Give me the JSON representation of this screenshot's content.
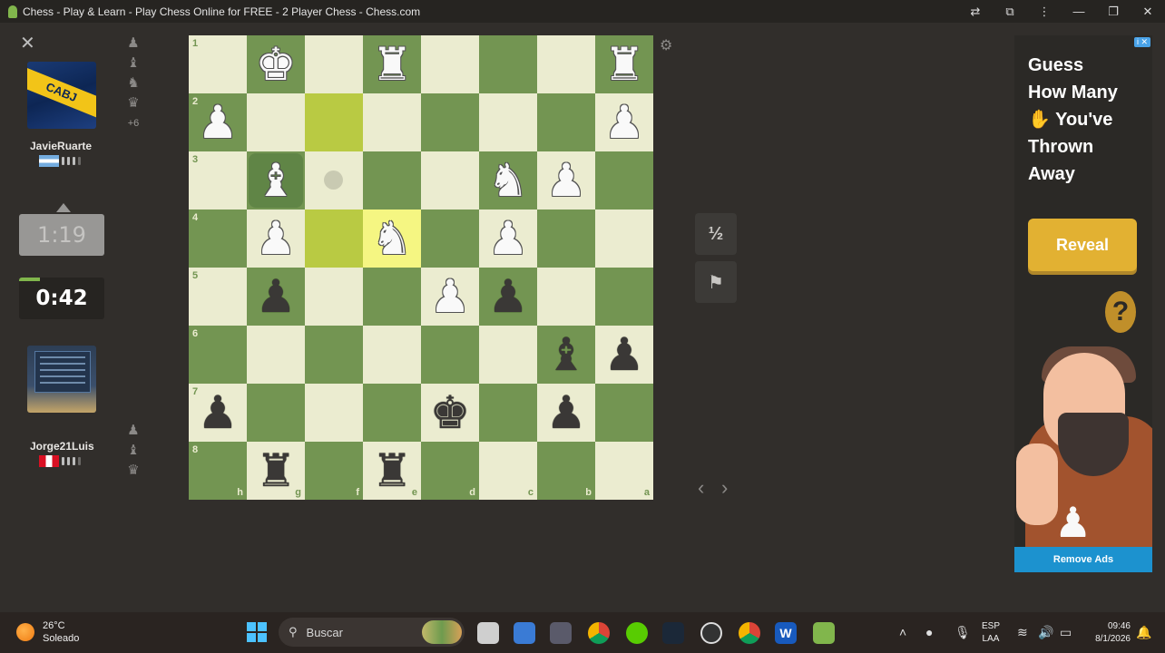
{
  "window": {
    "title": "Chess - Play & Learn - Play Chess Online for FREE - 2 Player Chess - Chess.com"
  },
  "top_player": {
    "name": "JavieRuarte",
    "avatar_text": "CABJ",
    "captured": [
      "♟",
      "♝",
      "♞",
      "♛"
    ],
    "advantage": "+6",
    "clock": "1:19"
  },
  "bottom_player": {
    "name": "Jorge21Luis",
    "captured": [
      "♟",
      "♝",
      "♛"
    ],
    "clock": "0:42"
  },
  "board": {
    "ranks": [
      "1",
      "2",
      "3",
      "4",
      "5",
      "6",
      "7",
      "8"
    ],
    "files": [
      "h",
      "g",
      "f",
      "e",
      "d",
      "c",
      "b",
      "a"
    ],
    "highlight_squares": [
      [
        1,
        2
      ],
      [
        3,
        2
      ],
      [
        3,
        3
      ]
    ],
    "selected_square": [
      2,
      1
    ],
    "move_hint_square": [
      2,
      2
    ],
    "pieces": [
      {
        "row": 0,
        "col": 1,
        "color": "w",
        "glyph": "♚",
        "name": "white-king"
      },
      {
        "row": 0,
        "col": 3,
        "color": "w",
        "glyph": "♜",
        "name": "white-rook"
      },
      {
        "row": 0,
        "col": 7,
        "color": "w",
        "glyph": "♜",
        "name": "white-rook"
      },
      {
        "row": 1,
        "col": 0,
        "color": "w",
        "glyph": "♟",
        "name": "white-pawn"
      },
      {
        "row": 1,
        "col": 7,
        "color": "w",
        "glyph": "♟",
        "name": "white-pawn"
      },
      {
        "row": 2,
        "col": 1,
        "color": "w",
        "glyph": "♝",
        "name": "white-bishop"
      },
      {
        "row": 2,
        "col": 5,
        "color": "w",
        "glyph": "♞",
        "name": "white-knight"
      },
      {
        "row": 2,
        "col": 6,
        "color": "w",
        "glyph": "♟",
        "name": "white-pawn"
      },
      {
        "row": 3,
        "col": 1,
        "color": "w",
        "glyph": "♟",
        "name": "white-pawn"
      },
      {
        "row": 3,
        "col": 3,
        "color": "w",
        "glyph": "♞",
        "name": "white-knight"
      },
      {
        "row": 3,
        "col": 5,
        "color": "w",
        "glyph": "♟",
        "name": "white-pawn"
      },
      {
        "row": 4,
        "col": 1,
        "color": "b",
        "glyph": "♟",
        "name": "black-pawn"
      },
      {
        "row": 4,
        "col": 4,
        "color": "w",
        "glyph": "♟",
        "name": "white-pawn"
      },
      {
        "row": 4,
        "col": 5,
        "color": "b",
        "glyph": "♟",
        "name": "black-pawn"
      },
      {
        "row": 5,
        "col": 6,
        "color": "b",
        "glyph": "♝",
        "name": "black-bishop"
      },
      {
        "row": 5,
        "col": 7,
        "color": "b",
        "glyph": "♟",
        "name": "black-pawn"
      },
      {
        "row": 6,
        "col": 0,
        "color": "b",
        "glyph": "♟",
        "name": "black-pawn"
      },
      {
        "row": 6,
        "col": 4,
        "color": "b",
        "glyph": "♚",
        "name": "black-king"
      },
      {
        "row": 6,
        "col": 6,
        "color": "b",
        "glyph": "♟",
        "name": "black-pawn"
      },
      {
        "row": 7,
        "col": 1,
        "color": "b",
        "glyph": "♜",
        "name": "black-rook"
      },
      {
        "row": 7,
        "col": 3,
        "color": "b",
        "glyph": "♜",
        "name": "black-rook"
      }
    ],
    "colors": {
      "light": "#ebecd0",
      "dark": "#739552",
      "highlight_light": "#f5f682",
      "highlight_dark": "#b9ca43"
    }
  },
  "controls": {
    "draw_label": "½",
    "resign_icon": "flag-icon",
    "prev_icon": "chevron-left-icon",
    "next_icon": "chevron-right-icon",
    "settings_icon": "gear-icon"
  },
  "ad": {
    "badge": "i ✕",
    "headline": "Guess\nHow Many\n✋ You've\nThrown\nAway",
    "cta": "Reveal",
    "remove_ads": "Remove Ads"
  },
  "taskbar": {
    "weather_temp": "26°C",
    "weather_desc": "Soleado",
    "search_placeholder": "Buscar",
    "lang_top": "ESP",
    "lang_bottom": "LAA",
    "time": "09:46",
    "date": "8/1/2026"
  }
}
